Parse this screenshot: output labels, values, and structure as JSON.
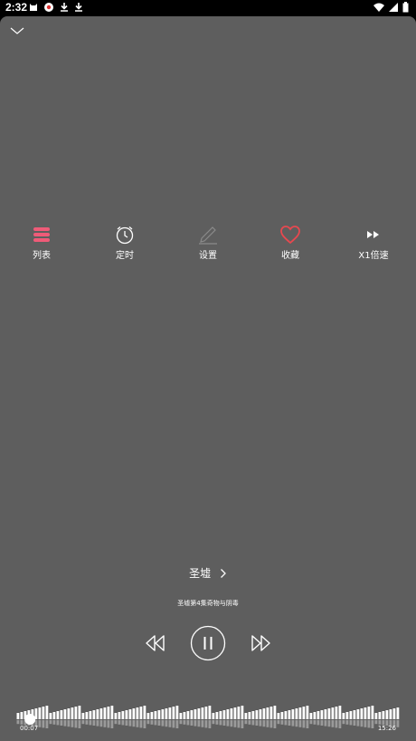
{
  "status_bar": {
    "time": "2:32",
    "left_icons": [
      "cat-icon",
      "game-icon",
      "download-icon",
      "download-icon"
    ],
    "right_icons": [
      "wifi-icon",
      "signal-icon",
      "battery-icon"
    ]
  },
  "actions": [
    {
      "label": "列表",
      "icon": "list-icon",
      "color": "#ef5b78"
    },
    {
      "label": "定时",
      "icon": "alarm-clock-icon",
      "color": "#ffffff"
    },
    {
      "label": "设置",
      "icon": "pencil-icon",
      "color": "#8a8a8a"
    },
    {
      "label": "收藏",
      "icon": "heart-icon",
      "color": "#e8484f"
    },
    {
      "label": "X1倍速",
      "icon": "fast-forward-icon",
      "color": "#ffffff"
    }
  ],
  "album": {
    "title": "圣墟"
  },
  "chapter": {
    "title": "圣墟第4集奇物与阴毒"
  },
  "progress": {
    "current": "00:07",
    "total": "15:26",
    "fraction": 0.008
  }
}
